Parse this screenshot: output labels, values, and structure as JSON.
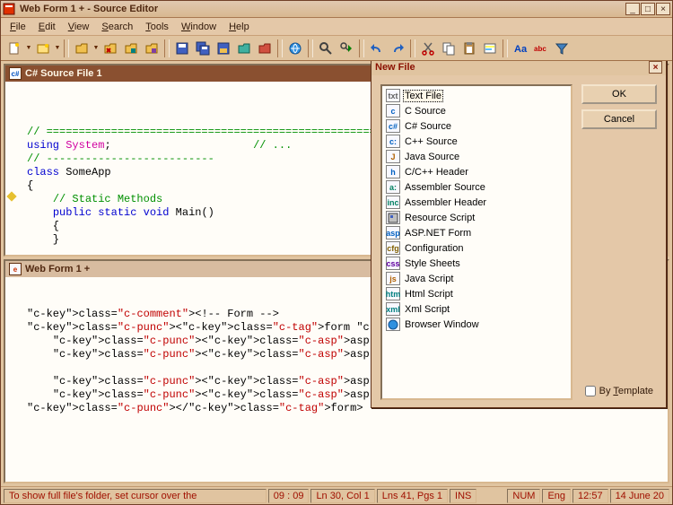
{
  "window": {
    "title": "Web Form 1 + - Source Editor"
  },
  "menu": {
    "file": "File",
    "edit": "Edit",
    "view": "View",
    "search": "Search",
    "tools": "Tools",
    "window": "Window",
    "help": "Help"
  },
  "toolbar_icons": [
    "new-file-icon",
    "new-project-icon",
    "sep",
    "open-folder-icon",
    "open-red-icon",
    "open-teal-icon",
    "open-purple-icon",
    "sep",
    "save-icon",
    "save-all-icon",
    "save-folder-icon",
    "folder-teal-icon",
    "folder-red-icon",
    "sep",
    "ie-icon",
    "sep",
    "find-icon",
    "find-next-icon",
    "sep",
    "undo-icon",
    "redo-icon",
    "sep",
    "cut-icon",
    "copy-icon",
    "paste-icon",
    "highlight-icon",
    "sep",
    "format-aa-icon",
    "format-abc-icon",
    "funnel-icon"
  ],
  "panes": {
    "csharp": {
      "badge": "c#",
      "title": "C# Source File 1",
      "bp_line": 9
    },
    "webform": {
      "badge": "e",
      "title": "Web Form 1 +"
    }
  },
  "code_csharp": {
    "l1_comment_bar": "// ==========================================================================",
    "l2_using": "using",
    "l2_system": "System",
    "l2_semi": ";",
    "l2_cmt": "// ...",
    "l3_dash": "// --------------------------",
    "l4_class": "class",
    "l4_name": "SomeApp",
    "l5_brace": "{",
    "l6_cmt": "// Static Methods",
    "l7_public": "public",
    "l7_static": "static",
    "l7_void": "void",
    "l7_main": "Main()",
    "l8_brace": "{",
    "l9_brace": "}"
  },
  "code_webform": {
    "l1_cmt": "<!-- Form -->",
    "l2": "<form runat=\"server\">",
    "l3": "    <asp:TextBox ID=\"Name\" runat=\"serve",
    "l4": "    <asp:RequiredFieldValidator Control",
    "l5": "",
    "l6": "    <asp:Button ID=\"Submit\" Text=\"Submi",
    "l7": "    <asp:Label  ID=\"Output\" runat=\"serv",
    "l8": "</form>"
  },
  "dialog": {
    "title": "New File",
    "ok": "OK",
    "cancel": "Cancel",
    "by_template": "By Template",
    "items": [
      {
        "icon": "txt",
        "label": "Text File",
        "selected": true
      },
      {
        "icon": "c",
        "label": "C Source"
      },
      {
        "icon": "c#",
        "label": "C# Source"
      },
      {
        "icon": "c:",
        "label": "C++ Source"
      },
      {
        "icon": "J",
        "label": "Java Source"
      },
      {
        "icon": "h",
        "label": "C/C++ Header"
      },
      {
        "icon": "a:",
        "label": "Assembler Source"
      },
      {
        "icon": "inc",
        "label": "Assembler Header"
      },
      {
        "icon": "rc",
        "label": "Resource Script"
      },
      {
        "icon": "asp",
        "label": "ASP.NET Form"
      },
      {
        "icon": "cfg",
        "label": "Configuration"
      },
      {
        "icon": "css",
        "label": "Style Sheets"
      },
      {
        "icon": "js",
        "label": "Java Script"
      },
      {
        "icon": "htm",
        "label": "Html Script"
      },
      {
        "icon": "xml",
        "label": "Xml Script"
      },
      {
        "icon": "ie",
        "label": "Browser Window"
      }
    ]
  },
  "status": {
    "hint": "To show full file's folder, set cursor over the",
    "time_pos": "09 : 09",
    "lncol": "Ln 30, Col 1",
    "lns": "Lns 41, Pgs 1",
    "ins": "INS",
    "num": "NUM",
    "lang": "Eng",
    "clock": "12:57",
    "date": "14 June 20"
  }
}
